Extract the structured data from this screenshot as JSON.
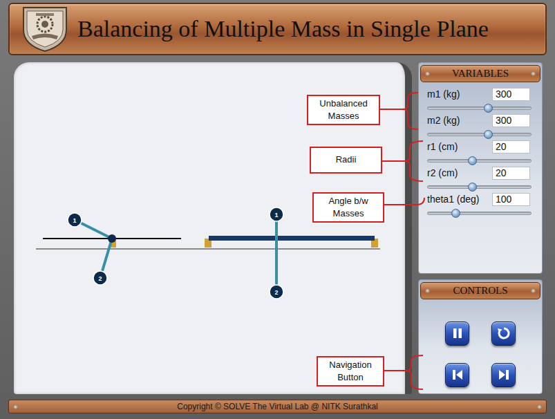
{
  "header": {
    "title": "Balancing of Multiple Mass in Single Plane"
  },
  "variables": {
    "title": "VARIABLES",
    "items": [
      {
        "label": "m1 (kg)",
        "value": "300",
        "level": 0.59
      },
      {
        "label": "m2 (kg)",
        "value": "300",
        "level": 0.59
      },
      {
        "label": "r1 (cm)",
        "value": "20",
        "level": 0.43
      },
      {
        "label": "r2 (cm)",
        "value": "20",
        "level": 0.43
      },
      {
        "label": "theta1 (deg)",
        "value": "100",
        "level": 0.27
      }
    ]
  },
  "controls": {
    "title": "CONTROLS"
  },
  "annotations": [
    {
      "text": "Unbalanced Masses"
    },
    {
      "text": "Radii"
    },
    {
      "text": "Angle b/w Masses"
    },
    {
      "text": "Navigation Button"
    }
  ],
  "diagram": {
    "end_view": {
      "masses": [
        {
          "label": "1"
        },
        {
          "label": "2"
        }
      ]
    },
    "side_view": {
      "masses": [
        {
          "label": "1"
        },
        {
          "label": "2"
        }
      ]
    }
  },
  "footer": {
    "text": "Copyright © SOLVE The Virtual Lab @ NITK Surathkal"
  }
}
